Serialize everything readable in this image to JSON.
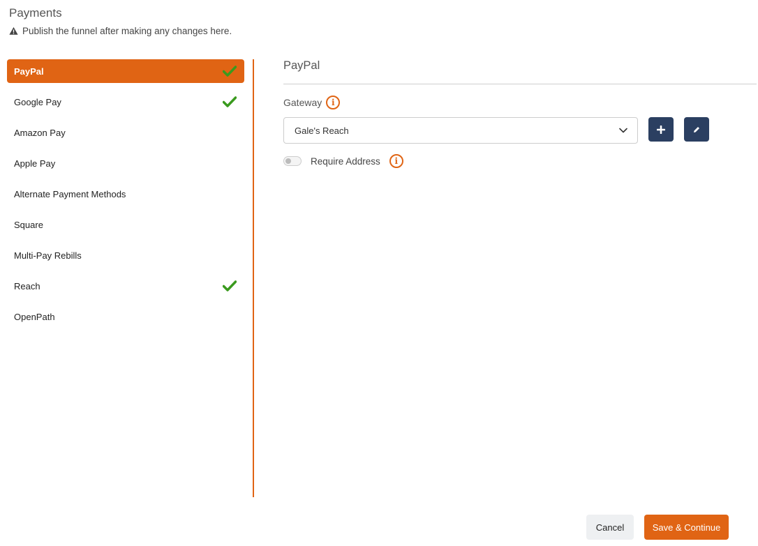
{
  "header": {
    "title": "Payments",
    "notice": "Publish the funnel after making any changes here."
  },
  "sidebar": {
    "items": [
      {
        "label": "PayPal",
        "active": true,
        "checked": true
      },
      {
        "label": "Google Pay",
        "active": false,
        "checked": true
      },
      {
        "label": "Amazon Pay",
        "active": false,
        "checked": false
      },
      {
        "label": "Apple Pay",
        "active": false,
        "checked": false
      },
      {
        "label": "Alternate Payment Methods",
        "active": false,
        "checked": false
      },
      {
        "label": "Square",
        "active": false,
        "checked": false
      },
      {
        "label": "Multi-Pay Rebills",
        "active": false,
        "checked": false
      },
      {
        "label": "Reach",
        "active": false,
        "checked": true
      },
      {
        "label": "OpenPath",
        "active": false,
        "checked": false
      }
    ]
  },
  "panel": {
    "title": "PayPal",
    "gateway_label": "Gateway",
    "gateway_value": "Gale's Reach",
    "require_address_label": "Require Address",
    "require_address_on": false
  },
  "footer": {
    "cancel_label": "Cancel",
    "save_label": "Save & Continue"
  },
  "colors": {
    "accent": "#e06414",
    "check": "#3a9a1e",
    "dark_button": "#2b3f61"
  },
  "icons": {
    "warning": "warning-triangle-icon",
    "check": "checkmark-icon",
    "info": "info-icon",
    "chevron": "chevron-down-icon",
    "add": "plus-icon",
    "edit": "pencil-icon"
  }
}
